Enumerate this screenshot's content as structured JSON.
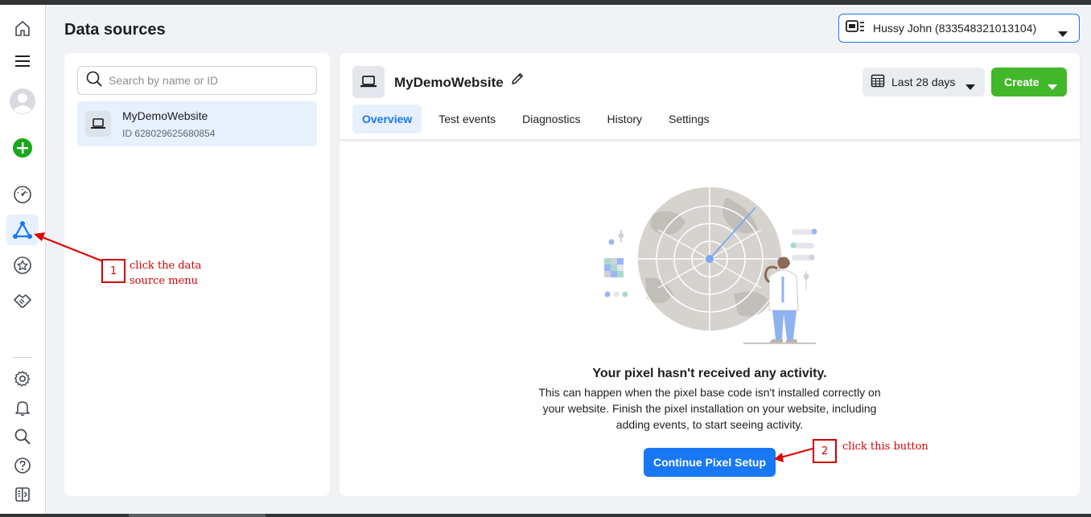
{
  "header": {
    "title": "Data sources",
    "account": "Hussy John (833548321013104)"
  },
  "left_panel": {
    "search_placeholder": "Search by name or ID",
    "items": [
      {
        "name": "MyDemoWebsite",
        "id": "ID 628029625680854"
      }
    ]
  },
  "detail": {
    "title": "MyDemoWebsite",
    "date_range": "Last 28 days",
    "create_label": "Create",
    "tabs": [
      "Overview",
      "Test events",
      "Diagnostics",
      "History",
      "Settings"
    ],
    "active_tab": "Overview",
    "empty_title": "Your pixel hasn't received any activity.",
    "empty_desc": "This can happen when the pixel base code isn't installed correctly on your website. Finish the pixel installation on your website, including adding events, to start seeing activity.",
    "cta_label": "Continue Pixel Setup"
  },
  "annotations": [
    {
      "number": "1",
      "text_line1": "click the data",
      "text_line2": "source menu"
    },
    {
      "number": "2",
      "text": "click this button"
    }
  ],
  "colors": {
    "accent": "#1877f2",
    "create": "#42b72a",
    "annotation": "#d40000"
  },
  "rail_icons": [
    "home-icon",
    "menu-icon",
    "avatar",
    "add-icon",
    "gauge-icon",
    "data-sources-icon",
    "star-icon",
    "handshake-icon",
    "gear-icon",
    "bell-icon",
    "search-icon",
    "help-icon",
    "panel-icon"
  ]
}
